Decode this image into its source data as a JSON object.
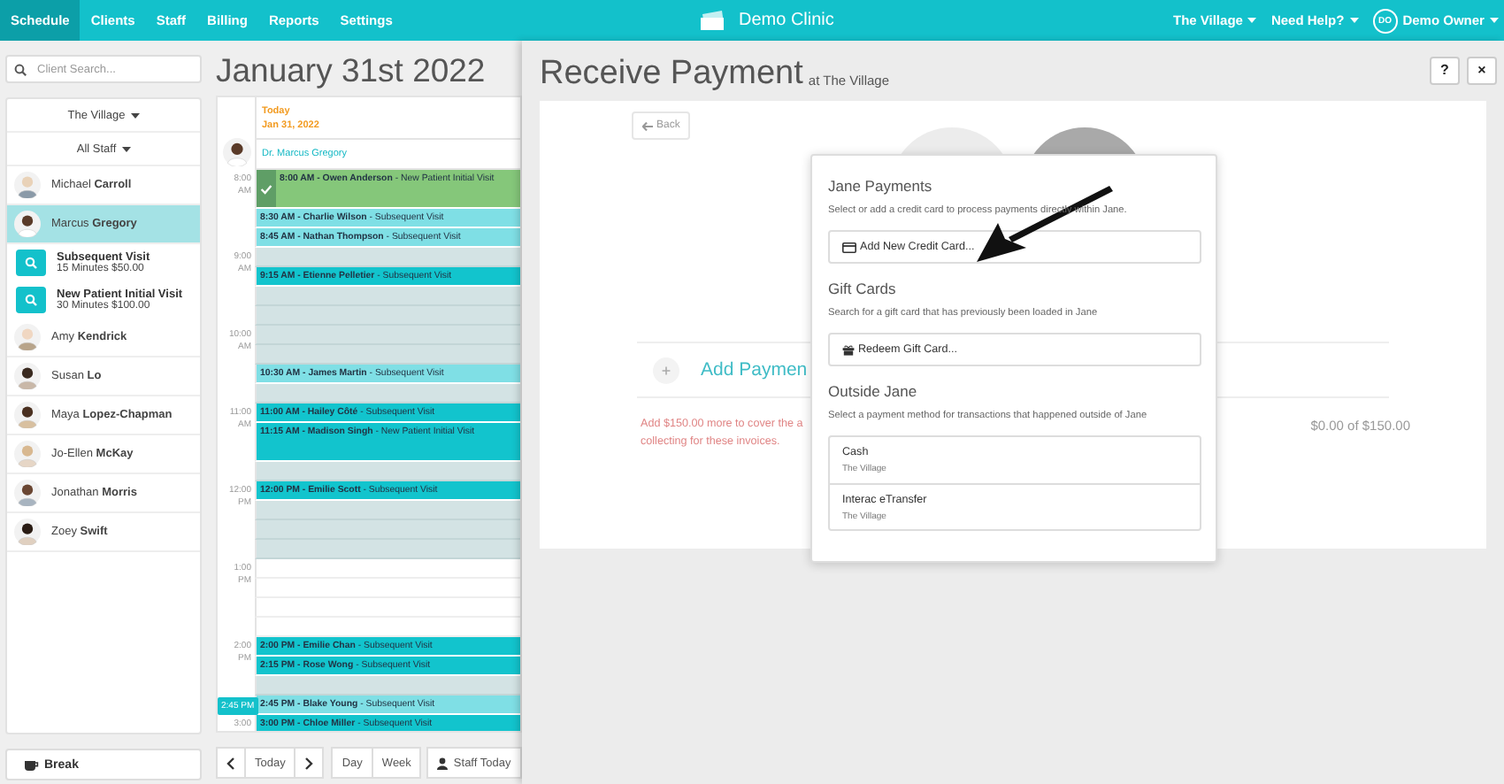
{
  "nav": {
    "items": [
      {
        "label": "Schedule",
        "selected": true
      },
      {
        "label": "Clients",
        "selected": false
      },
      {
        "label": "Staff",
        "selected": false
      },
      {
        "label": "Billing",
        "selected": false
      },
      {
        "label": "Reports",
        "selected": false
      },
      {
        "label": "Settings",
        "selected": false
      }
    ],
    "logo": "Demo Clinic",
    "location": "The Village",
    "help": "Need Help?",
    "user_initials": "DO",
    "user_name": "Demo Owner"
  },
  "sidebar": {
    "search": {
      "placeholder": "Client Search..."
    },
    "location": "The Village",
    "staff_filter": "All Staff",
    "staff": [
      {
        "name": "Michael **Carroll**",
        "selected": false
      },
      {
        "name": "Marcus **Gregory**",
        "selected": true,
        "treatments": [
          {
            "name": "Subsequent Visit",
            "details": "15 Minutes $50.00"
          },
          {
            "name": "New Patient Initial Visit",
            "details": "30 Minutes $100.00"
          }
        ]
      },
      {
        "name": "Amy **Kendrick**",
        "selected": false
      },
      {
        "name": "Susan **Lo**",
        "selected": false
      },
      {
        "name": "Maya **Lopez-Chapman**",
        "selected": false
      },
      {
        "name": "Jo-Ellen **McKay**",
        "selected": false
      },
      {
        "name": "Jonathan **Morris**",
        "selected": false
      },
      {
        "name": "Zoey **Swift**",
        "selected": false
      }
    ],
    "break_button": "Break"
  },
  "calendar": {
    "title": "January 31st 2022",
    "today": "Today",
    "date": "Jan 31, 2022",
    "practitioner": "Dr. Marcus Gregory",
    "hours": [
      {
        "time": "8:00",
        "period": "AM"
      },
      {
        "time": "9:00",
        "period": "AM"
      },
      {
        "time": "10:00",
        "period": "AM"
      },
      {
        "time": "11:00",
        "period": "AM"
      },
      {
        "time": "12:00",
        "period": "PM"
      },
      {
        "time": "1:00",
        "period": "PM"
      },
      {
        "time": "2:00",
        "period": "PM"
      },
      {
        "time": "3:00"
      }
    ],
    "slots": [
      {
        "kind": "appointment",
        "text": "**8:00 AM - Owen Anderson** - New Patient Initial Visit",
        "color": "#85c77a",
        "arrived": true,
        "long": true
      },
      {
        "kind": "appointment",
        "text": "**8:30 AM - Charlie Wilson** - Subsequent Visit",
        "color": "#7fdfe5",
        "arrived": false,
        "long": false
      },
      {
        "kind": "appointment",
        "text": "**8:45 AM - Nathan Thompson** - Subsequent Visit",
        "color": "#7fdfe5",
        "arrived": false,
        "long": false
      },
      {
        "kind": "open",
        "available": true
      },
      {
        "kind": "appointment",
        "text": "**9:15 AM - Etienne Pelletier** - Subsequent Visit",
        "color": "#12c4cd",
        "arrived": false,
        "long": false
      },
      {
        "kind": "open",
        "available": true
      },
      {
        "kind": "open",
        "available": true
      },
      {
        "kind": "open",
        "available": true
      },
      {
        "kind": "open",
        "available": true
      },
      {
        "kind": "appointment",
        "text": "**10:30 AM - James Martin** - Subsequent Visit",
        "color": "#7fdfe5",
        "arrived": false,
        "long": false
      },
      {
        "kind": "open",
        "available": true
      },
      {
        "kind": "appointment",
        "text": "**11:00 AM - Hailey Côté** - Subsequent Visit",
        "color": "#12c4cd",
        "arrived": false,
        "long": false
      },
      {
        "kind": "appointment",
        "text": "**11:15 AM - Madison Singh** - New Patient Initial Visit",
        "color": "#12c4cd",
        "arrived": false,
        "long": true
      },
      {
        "kind": "open",
        "available": true
      },
      {
        "kind": "appointment",
        "text": "**12:00 PM - Emilie Scott** - Subsequent Visit",
        "color": "#12c4cd",
        "arrived": false,
        "long": false
      },
      {
        "kind": "open",
        "available": true
      },
      {
        "kind": "open",
        "available": true
      },
      {
        "kind": "open",
        "available": true
      },
      {
        "kind": "open",
        "available": false
      },
      {
        "kind": "open",
        "available": false
      },
      {
        "kind": "open",
        "available": false
      },
      {
        "kind": "open",
        "available": false
      },
      {
        "kind": "appointment",
        "text": "**2:00 PM - Emilie Chan** - Subsequent Visit",
        "color": "#12c4cd",
        "arrived": false,
        "long": false
      },
      {
        "kind": "appointment",
        "text": "**2:15 PM - Rose Wong** - Subsequent Visit",
        "color": "#12c4cd",
        "arrived": false,
        "long": false
      },
      {
        "kind": "open",
        "available": true
      },
      {
        "kind": "appointment",
        "text": "**2:45 PM - Blake Young** - Subsequent Visit",
        "color": "#7fdfe5",
        "arrived": false,
        "long": false,
        "current_time": "2:45 PM"
      },
      {
        "kind": "appointment",
        "text": "**3:00 PM - Chloe Miller** - Subsequent Visit",
        "color": "#12c4cd",
        "arrived": false,
        "long": false
      }
    ],
    "buttons": {
      "today": "Today",
      "day": "Day",
      "week": "Week",
      "staff_today": "Staff Today"
    }
  },
  "payment": {
    "title": "Receive Payment",
    "subtitle": "at The Village",
    "help_button": "?",
    "close_button": "×",
    "back_button": "Back",
    "add_payment": "Add Paymen",
    "notice": [
      "Add $150.00 more to cover the a",
      "collecting for these invoices."
    ],
    "paid_total": "$0.00 of $150.00",
    "popover": {
      "sections": [
        {
          "kind": "card_action",
          "heading": "Jane Payments",
          "description": "Select or add a credit card to process payments directly within Jane.",
          "action": "Add New Credit Card..."
        },
        {
          "kind": "gift_action",
          "heading": "Gift Cards",
          "description": "Search for a gift card that has previously been loaded in Jane",
          "action": "Redeem Gift Card..."
        },
        {
          "kind": "method_list",
          "heading": "Outside Jane",
          "description": "Select a payment method for transactions that happened outside of Jane",
          "methods": [
            {
              "name": "Cash",
              "location": "The Village"
            },
            {
              "name": "Interac eTransfer",
              "location": "The Village"
            }
          ]
        }
      ]
    }
  }
}
